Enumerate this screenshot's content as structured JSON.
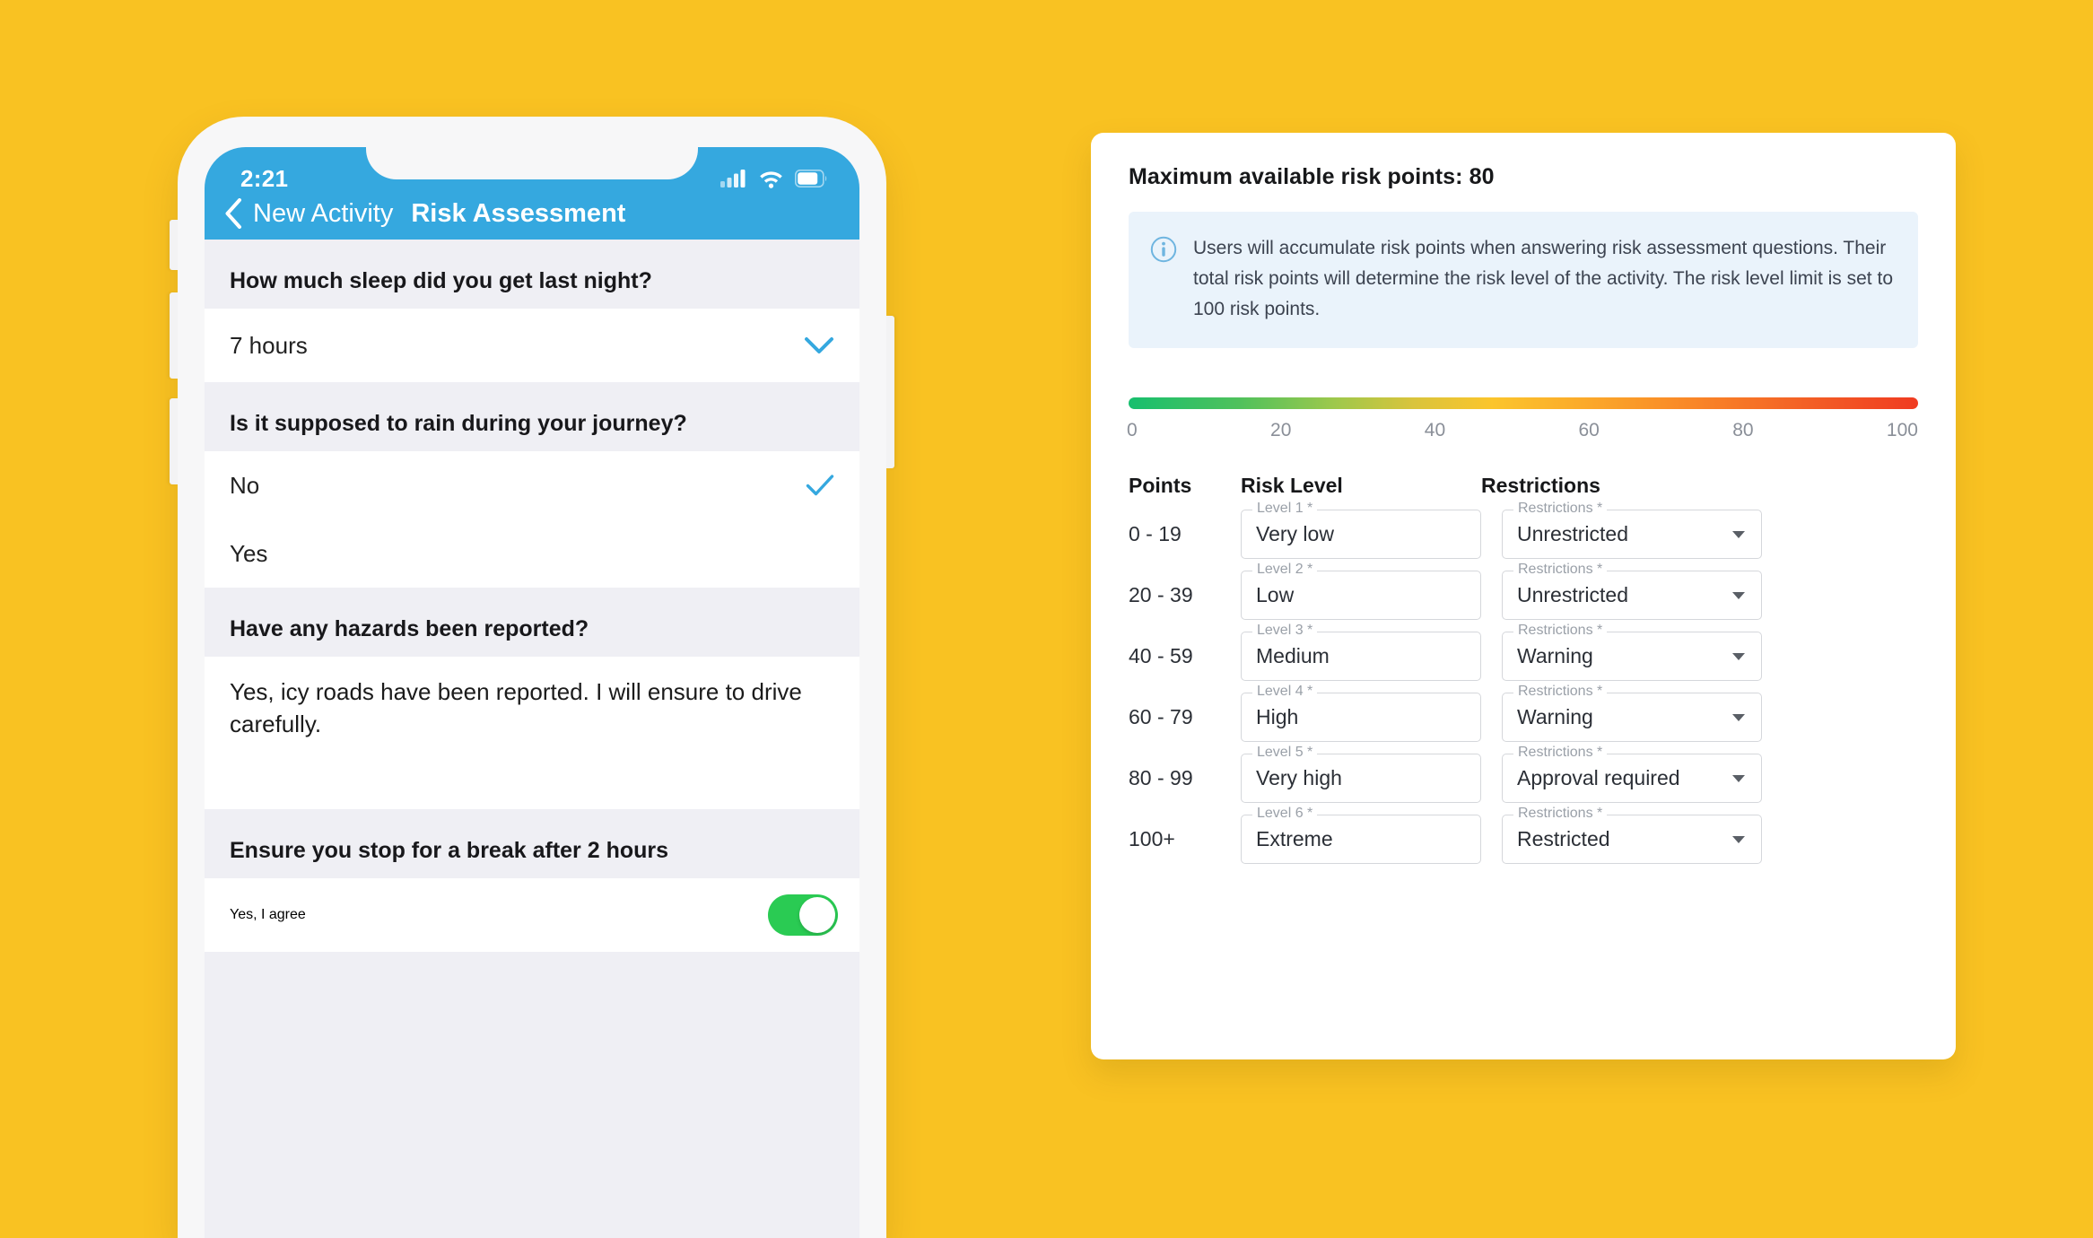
{
  "background_color": "#F9C222",
  "phone": {
    "status_bar": {
      "time": "2:21",
      "icons": [
        "cellular-signal-icon",
        "wifi-icon",
        "battery-icon"
      ]
    },
    "nav": {
      "back_icon": "chevron-left-icon",
      "back_label": "New Activity",
      "title": "Risk Assessment"
    },
    "questions": [
      {
        "type": "select",
        "label": "How much sleep did you get last night?",
        "value": "7 hours",
        "icon": "chevron-down-icon"
      },
      {
        "type": "radio",
        "label": "Is it supposed to rain during your journey?",
        "options": [
          {
            "value": "No",
            "selected": true,
            "icon": "check-icon"
          },
          {
            "value": "Yes",
            "selected": false
          }
        ]
      },
      {
        "type": "textarea",
        "label": "Have any hazards been reported?",
        "value": "Yes, icy roads have been reported. I will ensure to drive carefully."
      },
      {
        "type": "toggle",
        "label": "Ensure you stop for a break after 2 hours",
        "value": "Yes, I agree",
        "toggle_on": true,
        "toggle_color": "#2ACB53"
      }
    ]
  },
  "risk_card": {
    "title": "Maximum available risk points: 80",
    "info": {
      "icon": "info-icon",
      "text": "Users will accumulate risk points when answering risk assessment questions. Their total risk points will determine the risk level of the activity. The risk level limit is set to 100 risk points."
    },
    "scale": {
      "ticks": [
        "0",
        "20",
        "40",
        "60",
        "80",
        "100"
      ],
      "gradient_from": "#17BF6E",
      "gradient_mid": "#FBC52C",
      "gradient_to": "#F03B21"
    },
    "table": {
      "headers": {
        "points": "Points",
        "risk_level": "Risk Level",
        "restrictions": "Restrictions"
      },
      "rows": [
        {
          "points": "0 - 19",
          "level_label": "Level 1 *",
          "level_value": "Very low",
          "restriction_label": "Restrictions *",
          "restriction_value": "Unrestricted"
        },
        {
          "points": "20 - 39",
          "level_label": "Level 2 *",
          "level_value": "Low",
          "restriction_label": "Restrictions *",
          "restriction_value": "Unrestricted"
        },
        {
          "points": "40 - 59",
          "level_label": "Level 3 *",
          "level_value": "Medium",
          "restriction_label": "Restrictions *",
          "restriction_value": "Warning"
        },
        {
          "points": "60 - 79",
          "level_label": "Level 4 *",
          "level_value": "High",
          "restriction_label": "Restrictions *",
          "restriction_value": "Warning"
        },
        {
          "points": "80 - 99",
          "level_label": "Level 5 *",
          "level_value": "Very high",
          "restriction_label": "Restrictions *",
          "restriction_value": "Approval required"
        },
        {
          "points": "100+",
          "level_label": "Level 6 *",
          "level_value": "Extreme",
          "restriction_label": "Restrictions *",
          "restriction_value": "Restricted"
        }
      ]
    }
  }
}
